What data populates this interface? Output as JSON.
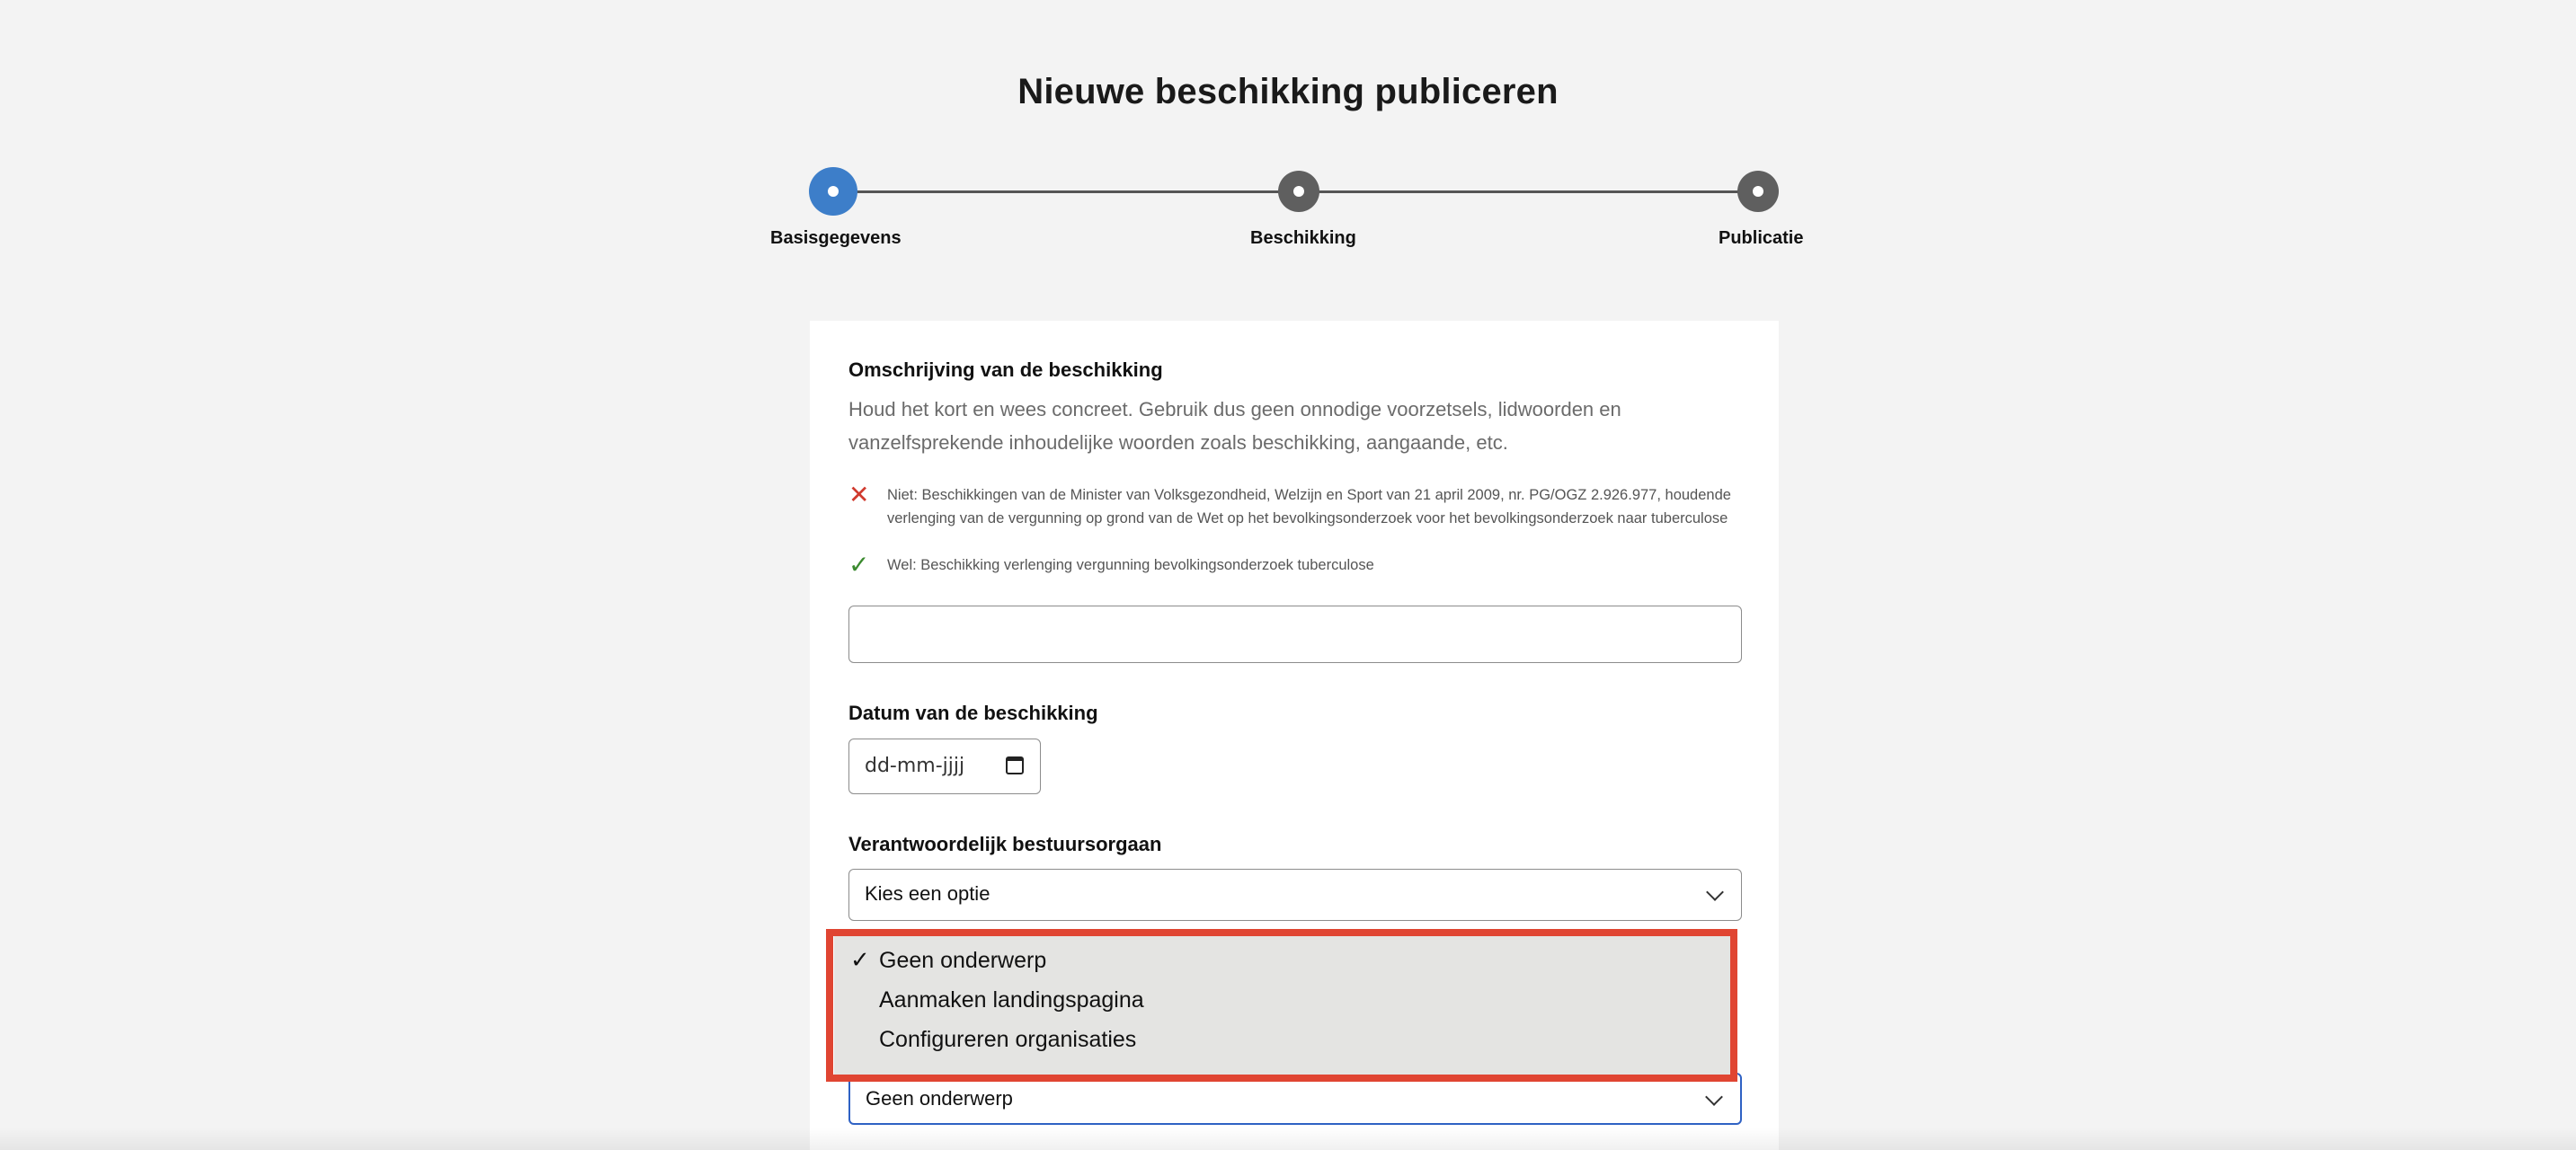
{
  "page": {
    "title": "Nieuwe beschikking publiceren"
  },
  "stepper": {
    "steps": [
      {
        "label": "Basisgegevens",
        "state": "active"
      },
      {
        "label": "Beschikking",
        "state": "upcoming"
      },
      {
        "label": "Publicatie",
        "state": "upcoming"
      }
    ],
    "active_color": "#3d7ec9",
    "inactive_color": "#5f5f5f"
  },
  "form": {
    "omschrijving": {
      "label": "Omschrijving van de beschikking",
      "help": "Houd het kort en wees concreet. Gebruik dus geen onnodige voorzetsels, lidwoorden en vanzelfsprekende inhoudelijke woorden zoals beschikking, aangaande, etc.",
      "example_bad": "Niet: Beschikkingen van de Minister van Volksgezondheid, Welzijn en Sport van 21 april 2009, nr. PG/OGZ 2.926.977, houdende verlenging van de vergunning op grond van de Wet op het bevolkingsonderzoek voor het bevolkingsonderzoek naar tuberculose",
      "example_good": "Wel: Beschikking verlenging vergunning bevolkingsonderzoek tuberculose",
      "value": ""
    },
    "datum": {
      "label": "Datum van de beschikking",
      "placeholder": "dd-mm-jjjj"
    },
    "bestuursorgaan": {
      "label": "Verantwoordelijk bestuursorgaan",
      "value": "Kies een optie"
    },
    "onderwerp": {
      "value": "Geen onderwerp",
      "options": [
        "Geen onderwerp",
        "Aanmaken landingspagina",
        "Configureren organisaties"
      ],
      "selected_index": 0
    }
  },
  "colors": {
    "error_icon": "#d03a2e",
    "success_icon": "#3a8a2e",
    "highlight_outline": "#e04532",
    "focus_border": "#2f62c4"
  }
}
